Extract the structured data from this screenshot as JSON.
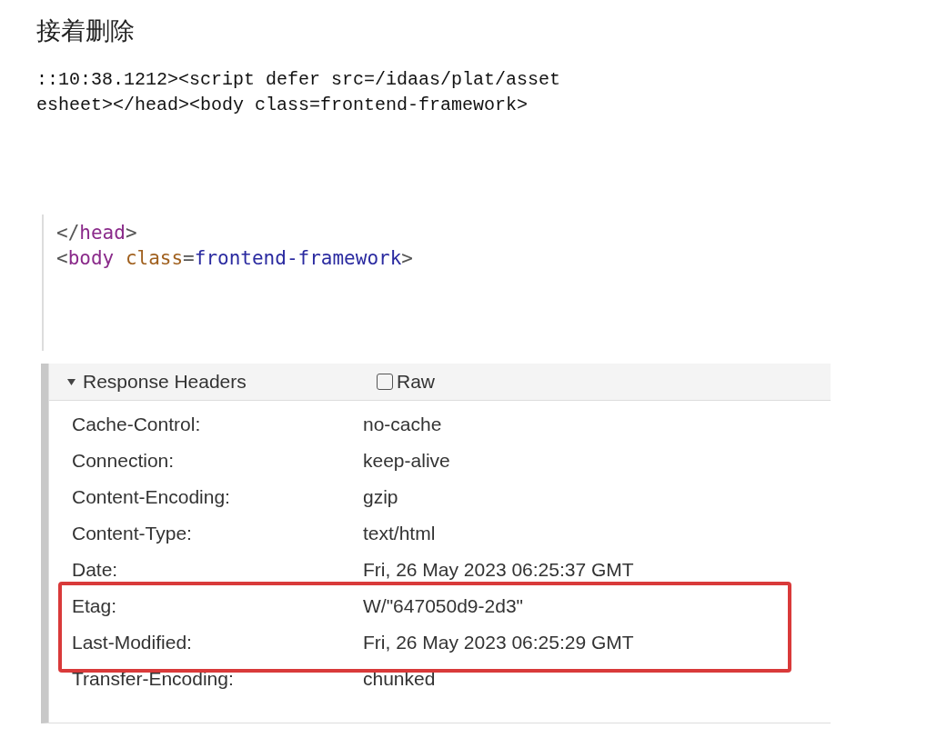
{
  "heading": "接着删除",
  "source_snippet": {
    "lines": [
      "::10:38.1212><script defer src=/idaas/plat/asset",
      "esheet></head><body class=frontend-framework>"
    ]
  },
  "elements_snippet": {
    "lines": [
      {
        "tokens": [
          {
            "text": "</",
            "kind": "punct"
          },
          {
            "text": "head",
            "kind": "tag"
          },
          {
            "text": ">",
            "kind": "punct"
          }
        ]
      },
      {
        "tokens": [
          {
            "text": "<",
            "kind": "punct"
          },
          {
            "text": "body",
            "kind": "tag"
          },
          {
            "text": "class",
            "kind": "attr",
            "space_before": true
          },
          {
            "text": "=",
            "kind": "punct"
          },
          {
            "text": "frontend-framework",
            "kind": "value"
          },
          {
            "text": ">",
            "kind": "punct"
          }
        ]
      }
    ]
  },
  "response_headers": {
    "title": "Response Headers",
    "expanded": true,
    "raw": {
      "label": "Raw",
      "checked": false
    },
    "rows": [
      {
        "name": "Cache-Control:",
        "value": "no-cache",
        "highlighted": false
      },
      {
        "name": "Connection:",
        "value": "keep-alive",
        "highlighted": false
      },
      {
        "name": "Content-Encoding:",
        "value": "gzip",
        "highlighted": false
      },
      {
        "name": "Content-Type:",
        "value": "text/html",
        "highlighted": false
      },
      {
        "name": "Date:",
        "value": "Fri, 26 May 2023 06:25:37 GMT",
        "highlighted": false
      },
      {
        "name": "Etag:",
        "value": "W/\"647050d9-2d3\"",
        "highlighted": true
      },
      {
        "name": "Last-Modified:",
        "value": "Fri, 26 May 2023 06:25:29 GMT",
        "highlighted": true
      },
      {
        "name": "Transfer-Encoding:",
        "value": "chunked",
        "highlighted": false
      }
    ]
  }
}
